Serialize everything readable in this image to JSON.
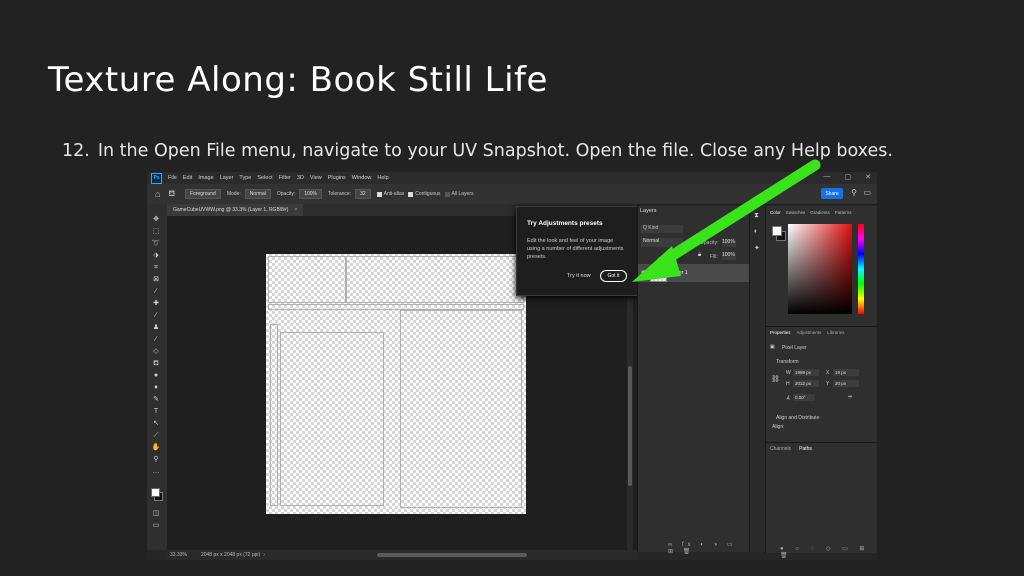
{
  "slide": {
    "title": "Texture Along: Book Still Life",
    "step_number": "12.",
    "step_text": "In the Open File menu, navigate to your UV Snapshot. Open the file. Close any Help boxes."
  },
  "photoshop": {
    "logo": "Ps",
    "menu": [
      "File",
      "Edit",
      "Image",
      "Layer",
      "Type",
      "Select",
      "Filter",
      "3D",
      "View",
      "Plugins",
      "Window",
      "Help"
    ],
    "window_controls": [
      "—",
      "▢",
      "✕"
    ],
    "options": {
      "sample_label": "Foreground",
      "mode_label": "Mode:",
      "mode_value": "Normal",
      "opacity_label": "Opacity:",
      "opacity_value": "100%",
      "tolerance_label": "Tolerance:",
      "tolerance_value": "32",
      "antialias": "Anti-alias",
      "contiguous": "Contiguous",
      "all_layers": "All Layers",
      "share": "Share"
    },
    "document_tab": "GameCubeUVWW.png @ 33.3% (Layer 1, RGB/8#)",
    "status": {
      "zoom": "33.33%",
      "size": "2048 px x 2048 px (72 ppi)"
    },
    "popup": {
      "title": "Try Adjustments presets",
      "body": "Edit the look and feel of your image using a number of different adjustments presets.",
      "try_label": "Try it now",
      "got_label": "Got it"
    },
    "layers": {
      "tab": "Layers",
      "search": "Q Kind",
      "blend": "Normal",
      "opacity_label": "Opacity:",
      "opacity_value": "100%",
      "fill_label": "Fill:",
      "fill_value": "100%",
      "layer_name": "Layer 1"
    },
    "color_tabs": [
      "Color",
      "Swatches",
      "Gradients",
      "Patterns"
    ],
    "properties": {
      "tabs": [
        "Properties",
        "Adjustments",
        "Libraries"
      ],
      "kind": "Pixel Layer",
      "transform": "Transform",
      "w": "W",
      "w_val": "1989 px",
      "x": "X",
      "x_val": "19 px",
      "h": "H",
      "h_val": "2012 px",
      "y": "Y",
      "y_val": "20 px",
      "angle": "0.00°",
      "align": "Align and Distribute",
      "align_sub": "Align:"
    },
    "channel_tabs": [
      "Channels",
      "Paths"
    ]
  },
  "colors": {
    "arrow": "#39e51a",
    "accent": "#1473e6"
  }
}
